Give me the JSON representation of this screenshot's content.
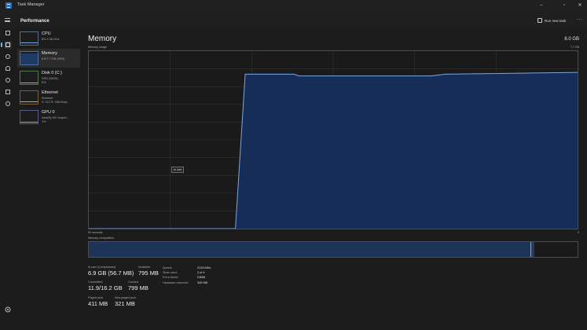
{
  "window": {
    "title": "Task Manager"
  },
  "header": {
    "page_name": "Performance",
    "run_task_label": "Run new task",
    "more_label": "···"
  },
  "devices": [
    {
      "name": "CPU",
      "sub1": "8% 2.36 GHz",
      "sub2": ""
    },
    {
      "name": "Memory",
      "sub1": "6.9/7.7 GB (90%)",
      "sub2": ""
    },
    {
      "name": "Disk 0 (C:)",
      "sub1": "SSD (SATA)",
      "sub2": "6%"
    },
    {
      "name": "Ethernet",
      "sub1": "Ethernet",
      "sub2": "S: 112 R: 336 Kbps"
    },
    {
      "name": "GPU 0",
      "sub1": "Intel(R) HD Graphi...",
      "sub2": "1%"
    }
  ],
  "main": {
    "title": "Memory",
    "total": "8.0 GB",
    "usage_label": "Memory usage",
    "max_label": "7.7 GB",
    "time_label": "60 seconds",
    "zero_label": "0",
    "tooltip": "In use",
    "composition_label": "Memory composition"
  },
  "stats": {
    "in_use": {
      "label": "In use (Compressed)",
      "value": "6.9 GB (56.7 MB)"
    },
    "available": {
      "label": "Available",
      "value": "795 MB"
    },
    "committed": {
      "label": "Committed",
      "value": "11.9/16.2 GB"
    },
    "cached": {
      "label": "Cached",
      "value": "799 MB"
    },
    "paged_pool": {
      "label": "Paged pool",
      "value": "411 MB"
    },
    "non_paged_pool": {
      "label": "Non-paged pool",
      "value": "321 MB"
    }
  },
  "specs": [
    {
      "key": "Speed:",
      "value": "2133 MHz"
    },
    {
      "key": "Slots used:",
      "value": "2 of 4"
    },
    {
      "key": "Form factor:",
      "value": "DIMM"
    },
    {
      "key": "Hardware reserved:",
      "value": "349 MB"
    }
  ],
  "colors": {
    "fill": "#162d57",
    "line": "#7ea6e0",
    "accent": "#76b9ed",
    "grid": "#333333"
  },
  "graph_usage": {
    "range": [
      0,
      7.7
    ],
    "unit": "GB",
    "points_pct": [
      [
        0,
        0
      ],
      [
        30,
        0
      ],
      [
        32,
        87
      ],
      [
        42,
        87
      ],
      [
        43,
        86
      ],
      [
        48,
        86
      ],
      [
        70,
        86
      ],
      [
        73,
        87
      ],
      [
        100,
        88
      ]
    ]
  },
  "composition": {
    "in_use_fraction": 0.905,
    "modified_fraction": 0.006
  }
}
